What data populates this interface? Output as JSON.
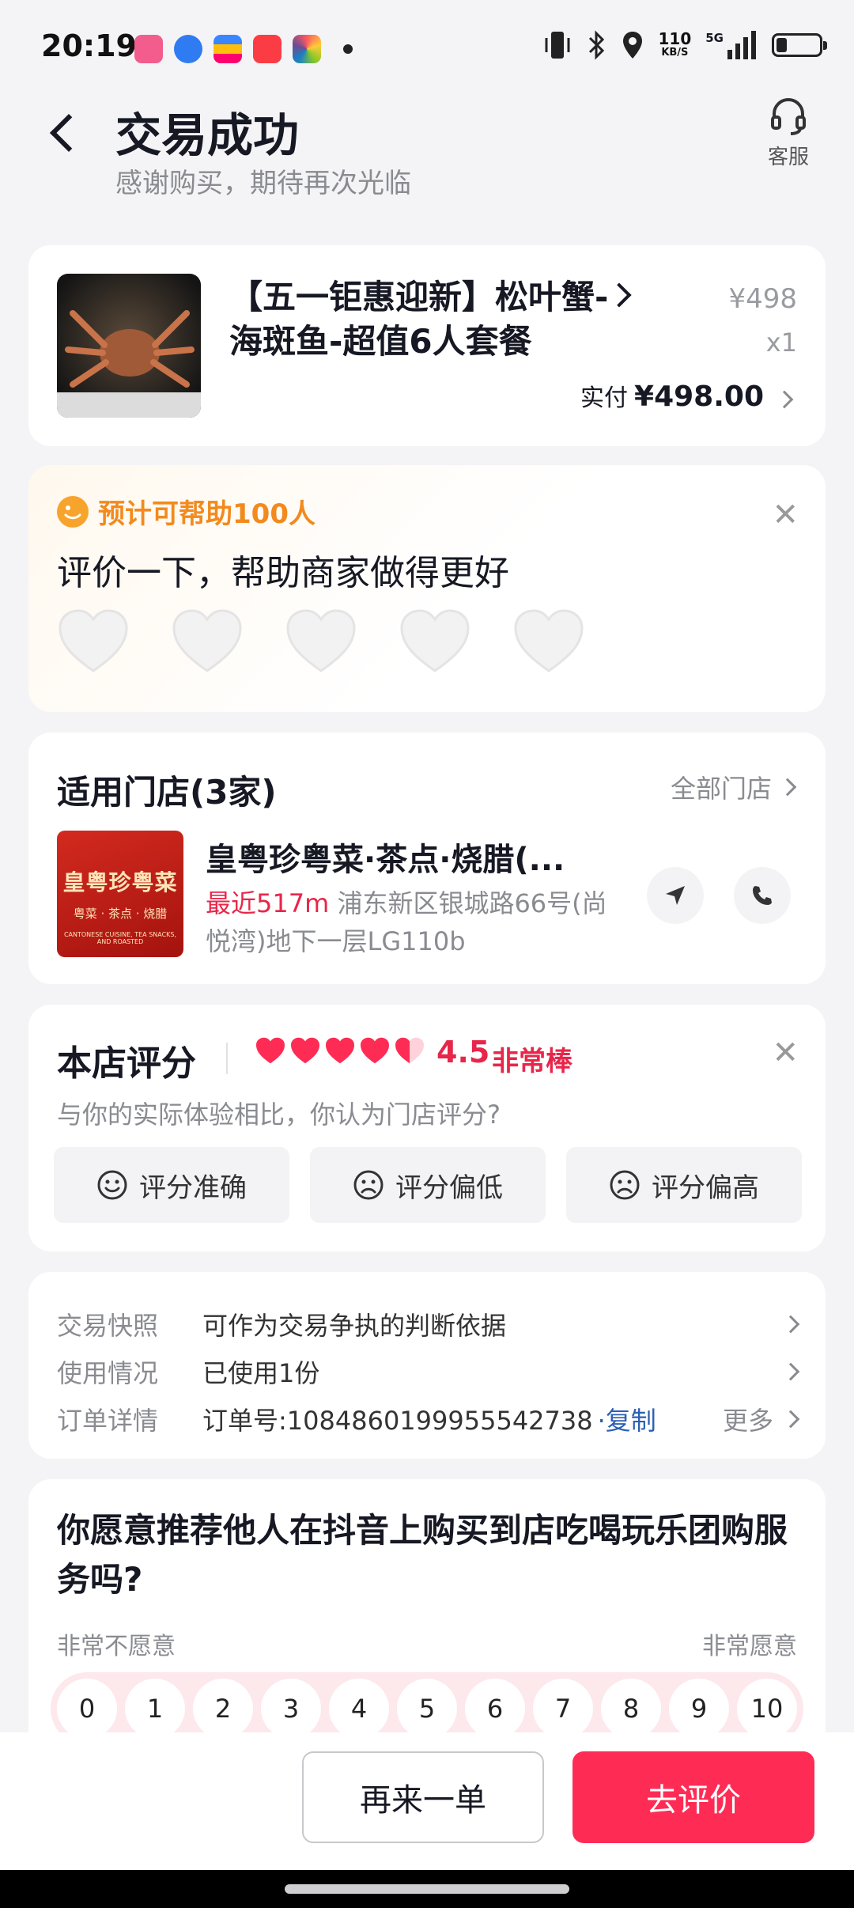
{
  "status_bar": {
    "time": "20:19",
    "net_speed_value": "110",
    "net_speed_unit": "KB/S",
    "network": "5G",
    "battery_level": 0.25
  },
  "header": {
    "title": "交易成功",
    "subtitle": "感谢购买，期待再次光临",
    "service_label": "客服"
  },
  "product": {
    "title": "【五一钜惠迎新】松叶蟹-海斑鱼-超值6人套餐",
    "price": "¥498",
    "quantity": "x1",
    "paid_label": "实付",
    "paid_amount": "¥498.00"
  },
  "review_prompt": {
    "tag": "预计可帮助100人",
    "title": "评价一下，帮助商家做得更好",
    "hearts_count": 5
  },
  "stores": {
    "heading": "适用门店(3家)",
    "all_link": "全部门店",
    "store_name": "皇粤珍粤菜·茶点·烧腊(...",
    "distance": "最近517m",
    "address": " 浦东新区银城路66号(尚悦湾)地下一层LG110b",
    "logo_text": "皇粤珍粤菜",
    "logo_sub": "粤菜 · 茶点 · 烧腊",
    "logo_en": "CANTONESE CUISINE, TEA SNACKS, AND ROASTED"
  },
  "store_score": {
    "heading": "本店评分",
    "score": "4.5",
    "score_word": "非常棒",
    "question": "与你的实际体验相比，你认为门店评分?",
    "options": [
      "评分准确",
      "评分偏低",
      "评分偏高"
    ]
  },
  "order_info": {
    "rows": [
      {
        "label": "交易快照",
        "value": "可作为交易争执的判断依据"
      },
      {
        "label": "使用情况",
        "value": "已使用1份"
      },
      {
        "label": "订单详情",
        "value": "订单号:1084860199955542738"
      }
    ],
    "copy_label": "·复制",
    "more_label": "更多"
  },
  "nps": {
    "question": "你愿意推荐他人在抖音上购买到店吃喝玩乐团购服务吗?",
    "left_label": "非常不愿意",
    "right_label": "非常愿意",
    "scale": [
      "0",
      "1",
      "2",
      "3",
      "4",
      "5",
      "6",
      "7",
      "8",
      "9",
      "10"
    ]
  },
  "actions": {
    "again_label": "再来一单",
    "review_label": "去评价"
  },
  "colors": {
    "accent": "#fe2c55",
    "score_red": "#e8264a",
    "tag_orange": "#f28a1d",
    "link_blue": "#2b5fb3"
  }
}
